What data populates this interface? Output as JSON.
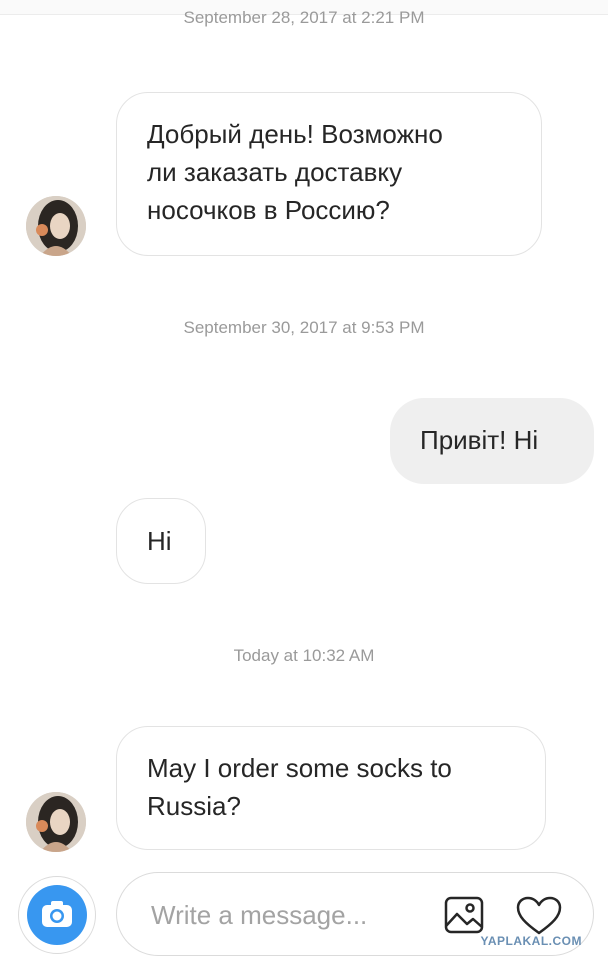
{
  "thread": {
    "timestamps": {
      "first": "September 28, 2017 at 2:21 PM",
      "second": "September 30, 2017 at 9:53 PM",
      "third": "Today at 10:32 AM"
    },
    "messages": [
      {
        "lines": [
          "Добрый день! Возможно",
          "ли заказать доставку",
          "носочков в Россию?"
        ]
      },
      {
        "text": "Привіт! Hi"
      },
      {
        "text": "Hi"
      },
      {
        "lines": [
          "May I order some socks to",
          "Russia?"
        ]
      }
    ]
  },
  "composer": {
    "placeholder": "Write a message...",
    "icons": {
      "camera": "camera-icon",
      "gallery": "gallery-icon",
      "like": "heart-icon"
    },
    "accent": "#3897f0"
  },
  "watermark": "YAPLAKAL.COM"
}
